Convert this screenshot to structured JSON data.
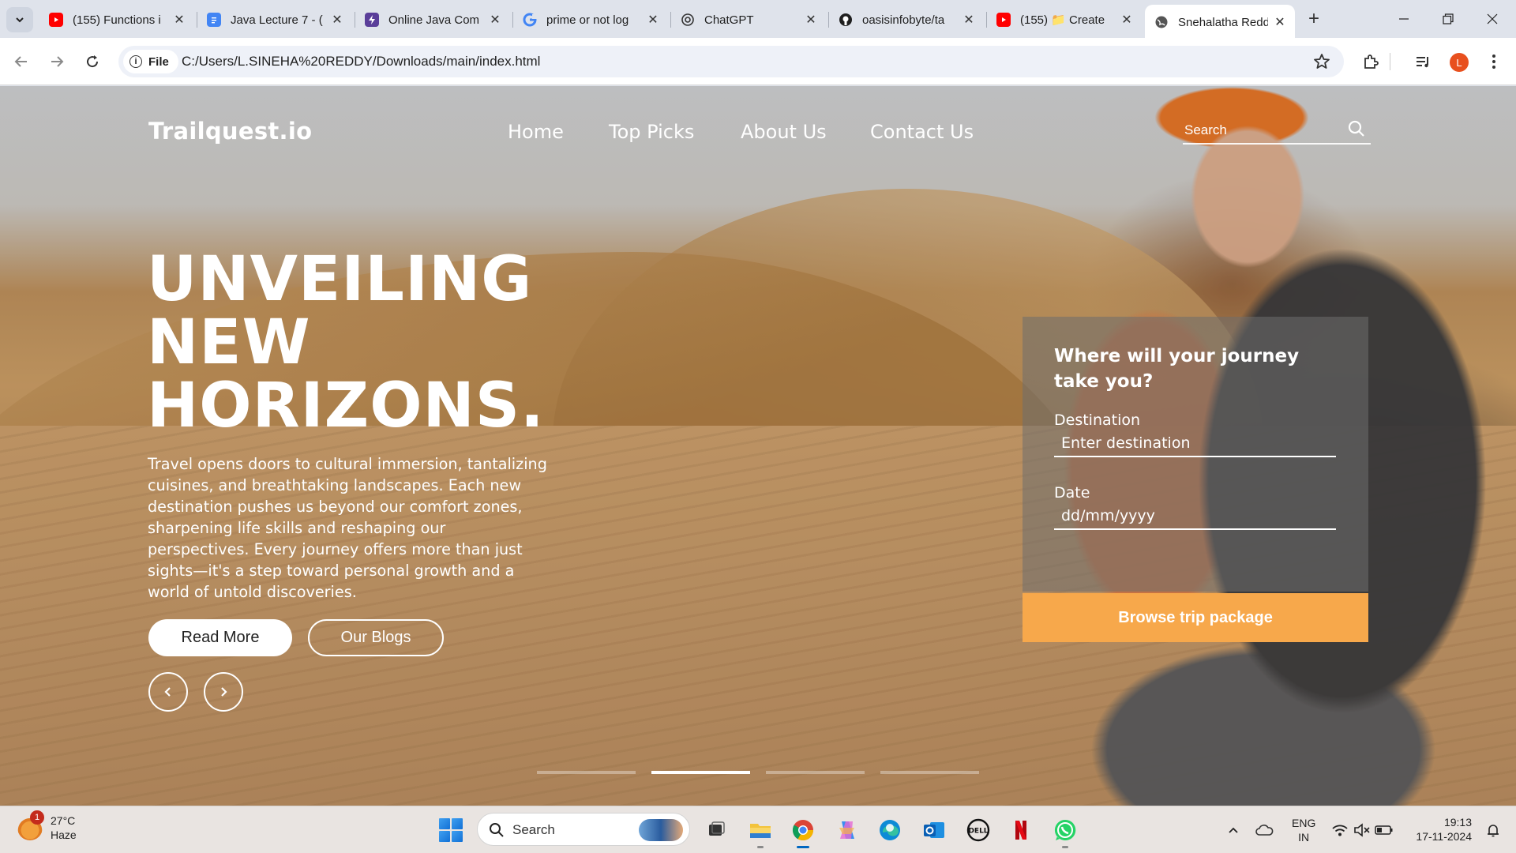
{
  "browser": {
    "tabs": [
      {
        "title": "(155) Functions i",
        "icon": "youtube-icon",
        "color": "#ff0000"
      },
      {
        "title": "Java Lecture 7 - (",
        "icon": "docs-icon",
        "color": "#4285f4"
      },
      {
        "title": "Online Java Com",
        "icon": "bolt-icon",
        "color": "#5a3e99"
      },
      {
        "title": "prime or not log",
        "icon": "google-icon",
        "color": "#4285f4"
      },
      {
        "title": "ChatGPT",
        "icon": "chatgpt-icon",
        "color": "#333333"
      },
      {
        "title": "oasisinfobyte/ta",
        "icon": "github-icon",
        "color": "#1f1f1f"
      },
      {
        "title": "(155) 📁 Create",
        "icon": "youtube-icon",
        "color": "#ff0000"
      },
      {
        "title": "Snehalatha Redd",
        "icon": "globe-icon",
        "color": "#555555",
        "active": true
      }
    ],
    "new_tab_label": "+",
    "site_chip": "File",
    "url": "C:/Users/L.SINEHA%20REDDY/Downloads/main/index.html",
    "profile_initial": "L"
  },
  "site": {
    "logo": "Trailquest.io",
    "nav": [
      "Home",
      "Top Picks",
      "About Us",
      "Contact Us"
    ],
    "search_placeholder": "Search",
    "hero": {
      "title_lines": [
        "UNVEILING",
        "NEW",
        "HORIZONS."
      ],
      "text": "Travel opens doors to cultural immersion, tantalizing cuisines, and breathtaking landscapes. Each new destination pushes us beyond our comfort zones, sharpening life skills and reshaping our perspectives. Every journey offers more than just sights—it's a step toward personal growth and a world of untold discoveries.",
      "read_more": "Read More",
      "our_blogs": "Our Blogs"
    },
    "booking": {
      "question": "Where will your journey take you?",
      "destination_label": "Destination",
      "destination_placeholder": "Enter destination",
      "date_label": "Date",
      "date_placeholder": "dd/mm/yyyy",
      "button": "Browse trip package",
      "button_color": "#f7a84b"
    },
    "slider": {
      "count": 4,
      "active_index": 1
    }
  },
  "taskbar": {
    "weather": {
      "badge": "1",
      "temp": "27°C",
      "condition": "Haze"
    },
    "search_label": "Search",
    "apps": [
      "task-view-icon",
      "file-explorer-icon",
      "chrome-icon",
      "copilot-icon",
      "edge-icon",
      "outlook-icon",
      "dell-icon",
      "netflix-icon",
      "whatsapp-icon"
    ],
    "lang": [
      "ENG",
      "IN"
    ],
    "time": "19:13",
    "date": "17-11-2024"
  }
}
